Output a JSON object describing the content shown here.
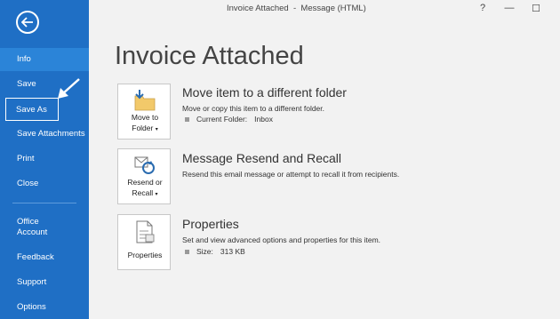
{
  "window": {
    "title": "Invoice Attached  -  Message (HTML)",
    "help": "?",
    "minimize": "—",
    "maximize": "☐"
  },
  "sidebar": {
    "items": [
      {
        "label": "Info"
      },
      {
        "label": "Save"
      },
      {
        "label": "Save As"
      },
      {
        "label": "Save Attachments"
      },
      {
        "label": "Print"
      },
      {
        "label": "Close"
      },
      {
        "label": "Office Account"
      },
      {
        "label": "Feedback"
      },
      {
        "label": "Support"
      },
      {
        "label": "Options"
      }
    ]
  },
  "main": {
    "title": "Invoice Attached",
    "sections": [
      {
        "tile_line1": "Move to",
        "tile_line2": "Folder",
        "title": "Move item to a different folder",
        "description": "Move or copy this item to a different folder.",
        "meta_label": "Current Folder:",
        "meta_value": "Inbox"
      },
      {
        "tile_line1": "Resend or",
        "tile_line2": "Recall",
        "title": "Message Resend and Recall",
        "description": "Resend this email message or attempt to recall it from recipients."
      },
      {
        "tile_line1": "Properties",
        "title": "Properties",
        "description": "Set and view advanced options and properties for this item.",
        "meta_label": "Size:",
        "meta_value": "313 KB"
      }
    ]
  },
  "colors": {
    "sidebar": "#1f6fc5",
    "sidebar_active": "#2b84d8",
    "background": "#f2f2f2"
  }
}
